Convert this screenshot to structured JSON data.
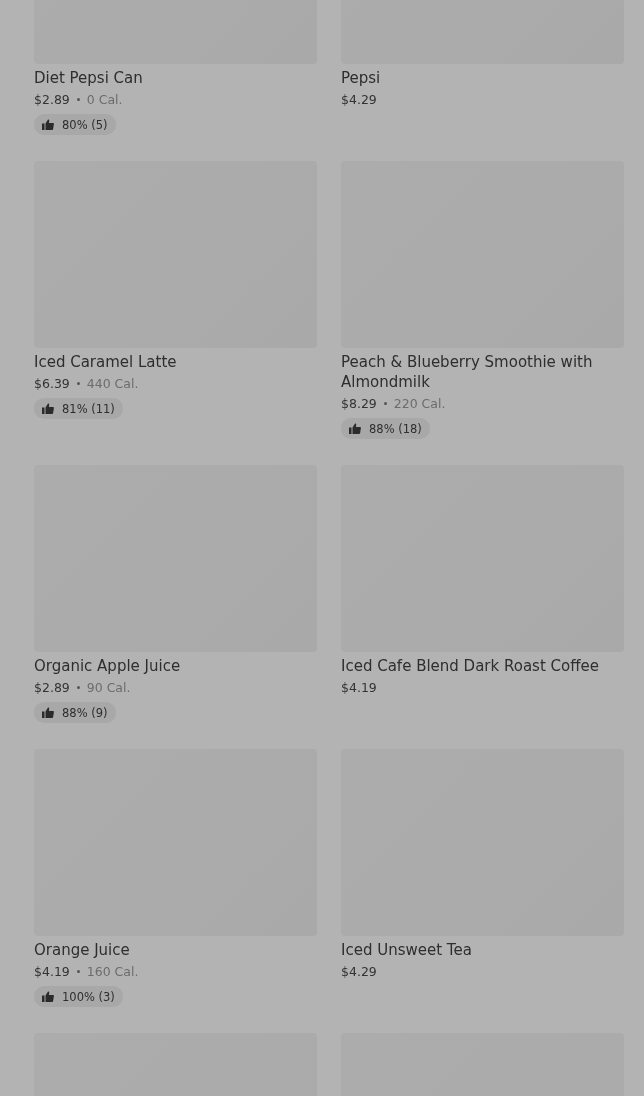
{
  "products": [
    {
      "kind": "product",
      "name": "Diet Pepsi Can",
      "price": "$2.89",
      "calories": "0 Cal.",
      "rating": "80% (5)"
    },
    {
      "kind": "product",
      "name": "Pepsi",
      "price": "$4.29"
    },
    {
      "kind": "product",
      "name": "Iced Caramel Latte",
      "price": "$6.39",
      "calories": "440 Cal.",
      "rating": "81% (11)"
    },
    {
      "kind": "product",
      "name": "Peach & Blueberry Smoothie with Almondmilk",
      "price": "$8.29",
      "calories": "220 Cal.",
      "rating": "88% (18)"
    },
    {
      "kind": "product",
      "name": "Organic Apple Juice",
      "price": "$2.89",
      "calories": "90 Cal.",
      "rating": "88% (9)"
    },
    {
      "kind": "product",
      "name": "Iced Cafe Blend Dark Roast Coffee",
      "price": "$4.19"
    },
    {
      "kind": "product",
      "name": "Orange Juice",
      "price": "$4.19",
      "calories": "160 Cal.",
      "rating": "100% (3)"
    },
    {
      "kind": "product",
      "name": "Iced Unsweet Tea",
      "price": "$4.29"
    },
    {
      "kind": "image-only"
    },
    {
      "kind": "image-only"
    }
  ]
}
